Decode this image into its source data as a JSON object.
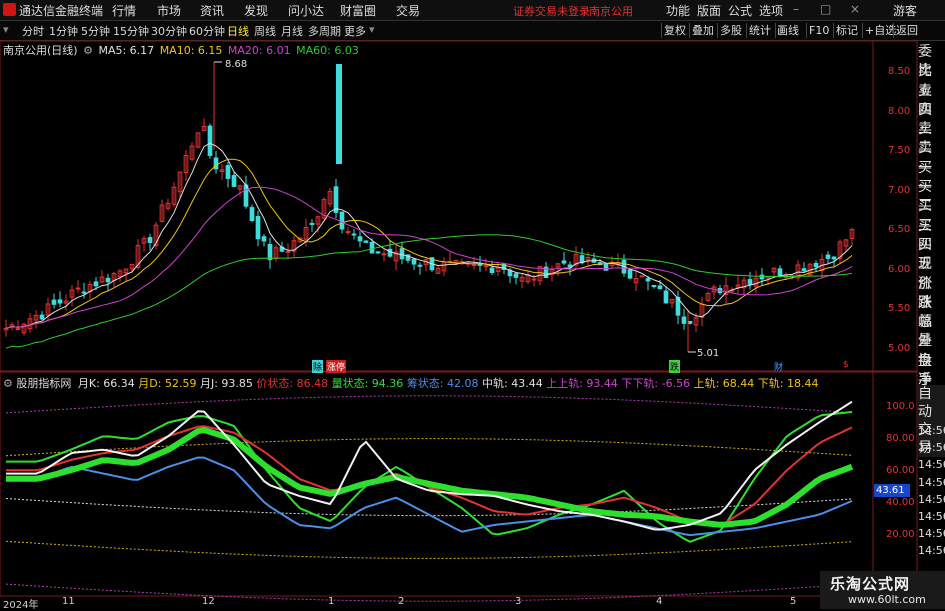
{
  "menu": {
    "app_title": "通达信金融终端",
    "items": [
      "行情",
      "市场",
      "资讯",
      "发现",
      "问小达",
      "财富圈",
      "交易"
    ],
    "notice_1": "证券交易未登录",
    "notice_2": "南京公用",
    "right_items": [
      "功能",
      "版面",
      "公式",
      "选项"
    ],
    "user": "游客"
  },
  "periods": [
    "分时",
    "1分钟",
    "5分钟",
    "15分钟",
    "30分钟",
    "60分钟",
    "日线",
    "周线",
    "月线",
    "多周期",
    "更多"
  ],
  "selected_period": "日线",
  "toolbar_buttons": [
    "复权",
    "叠加",
    "多股",
    "统计",
    "画线",
    "F10",
    "标记",
    "+自选",
    "返回"
  ],
  "price_panel": {
    "stock": "南京公用(日线)",
    "ma5": "MA5: 6.17",
    "ma10": "MA10: 6.15",
    "ma20": "MA20: 6.01",
    "ma60": "MA60: 6.03",
    "axis_labels": [
      "8.50",
      "8.00",
      "7.50",
      "7.00",
      "6.50",
      "6.00",
      "5.50",
      "5.00"
    ],
    "high_mark": "8.68",
    "low_mark": "5.01",
    "markers": [
      "除",
      "涨停",
      "跌",
      "财",
      "$"
    ]
  },
  "indicator_panel": {
    "name": "股朋指标网",
    "k": "月K: 66.34",
    "d": "月D: 52.59",
    "j": "月J: 93.85",
    "s1": "价状态: 86.48",
    "s2": "量状态: 94.36",
    "s3": "筹状态: 42.08",
    "mid": "中轨: 43.44",
    "up1": "上上轨: 93.44",
    "dn1": "下下轨: -6.56",
    "up2": "上轨: 68.44",
    "dn2": "下轨: 18.44",
    "axis_labels": [
      "100.0",
      "80.00",
      "60.00",
      "40.00",
      "20.00"
    ],
    "current_value": "43.61"
  },
  "dates": [
    "2024年",
    "11",
    "12",
    "1",
    "2",
    "3",
    "4",
    "5"
  ],
  "side_panel": {
    "items": [
      "委比",
      "卖五",
      "卖四",
      "卖三",
      "卖二",
      "卖一",
      "买一",
      "买二",
      "买三",
      "买四",
      "买五",
      "现价",
      "涨跌",
      "涨幅",
      "总量",
      "外盘",
      "换手",
      "净资",
      "收益"
    ],
    "lower_items": [
      "自动",
      "交易"
    ],
    "times": [
      "14:56",
      "14:56",
      "14:56",
      "14:56",
      "14:56",
      "14:56",
      "14:56",
      "14:56",
      "14:56"
    ]
  },
  "watermark": {
    "line1": "乐淘公式网",
    "line2": "www.60lt.com"
  },
  "colors": {
    "up": "#e23232",
    "down": "#3fdcdc",
    "ma5": "#e0e0e0",
    "ma10": "#f0c419",
    "ma20": "#d040d0",
    "ma60": "#2ecc2e"
  }
}
